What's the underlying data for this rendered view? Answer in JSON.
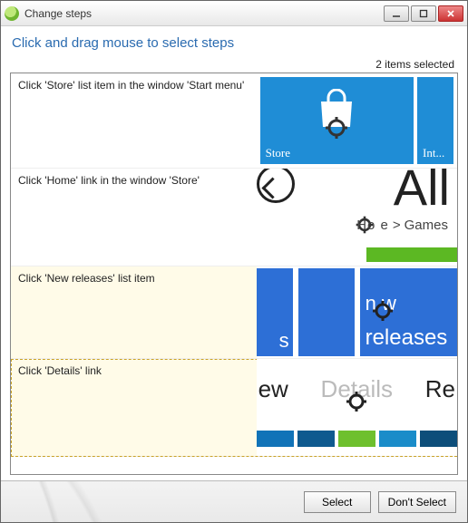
{
  "window": {
    "title": "Change steps"
  },
  "instruction": "Click and drag mouse to select steps",
  "selection_count_text": "2 items selected",
  "steps": [
    {
      "description": "Click 'Store' list item in the window 'Start menu'",
      "selected": false,
      "tiles": {
        "main_label": "Store",
        "side_label": "Int..."
      }
    },
    {
      "description": "Click 'Home' link in the window 'Store'",
      "selected": false,
      "content": {
        "big_text": "All",
        "breadcrumb_left": "Ho   e",
        "breadcrumb_sep": ">",
        "breadcrumb_right": "Games"
      }
    },
    {
      "description": "Click 'New releases' list item",
      "selected": true,
      "tiles": {
        "left_frag": "s",
        "mid_line1": "n  w",
        "mid_line2": "releases"
      }
    },
    {
      "description": "Click 'Details' link",
      "selected": true,
      "content": {
        "left": "ew",
        "mid": "Details",
        "right": "Re"
      }
    }
  ],
  "buttons": {
    "select": "Select",
    "dont_select": "Don't Select"
  }
}
